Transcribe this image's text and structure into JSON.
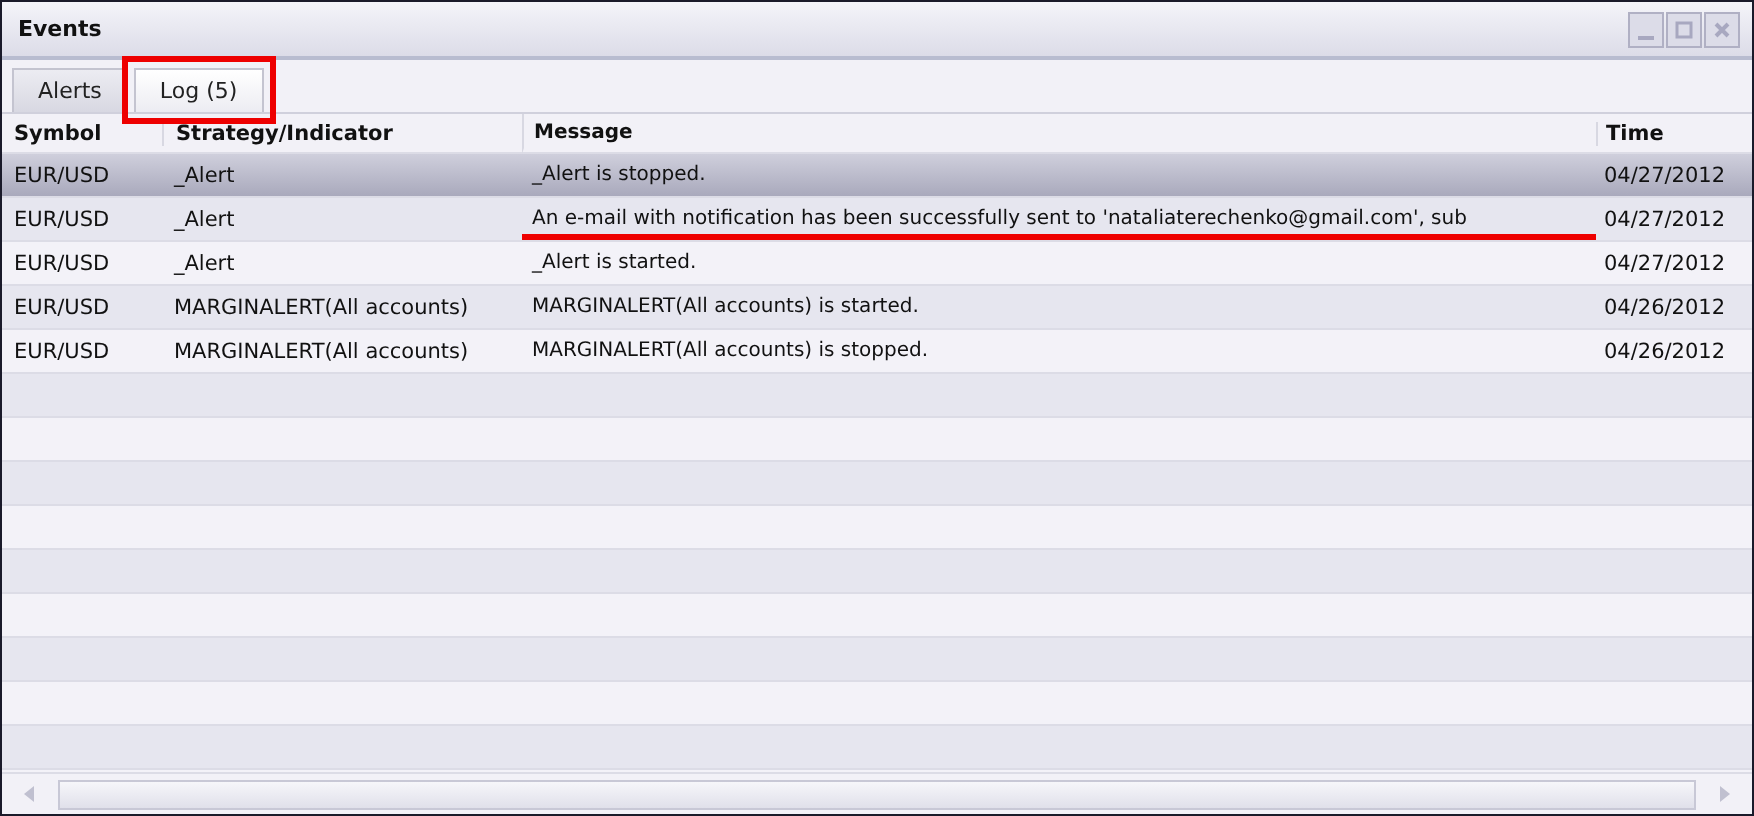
{
  "window": {
    "title": "Events"
  },
  "tabs": [
    {
      "label": "Alerts",
      "selected": false,
      "annotated": false
    },
    {
      "label": "Log (5)",
      "selected": true,
      "annotated": true
    }
  ],
  "table": {
    "columns": [
      "Symbol",
      "Strategy/Indicator",
      "Message",
      "Time"
    ],
    "rows": [
      {
        "cells": [
          "EUR/USD",
          "_Alert",
          "_Alert is stopped.",
          "04/27/2012"
        ],
        "selected": true,
        "underlined": false
      },
      {
        "cells": [
          "EUR/USD",
          "_Alert",
          "An e-mail with notification has been successfully sent to 'nataliaterechenko@gmail.com', sub",
          "04/27/2012"
        ],
        "selected": false,
        "underlined": true
      },
      {
        "cells": [
          "EUR/USD",
          "_Alert",
          "_Alert is started.",
          "04/27/2012"
        ],
        "selected": false,
        "underlined": false
      },
      {
        "cells": [
          "EUR/USD",
          "MARGINALERT(All accounts)",
          "MARGINALERT(All accounts) is started.",
          "04/26/2012"
        ],
        "selected": false,
        "underlined": false
      },
      {
        "cells": [
          "EUR/USD",
          "MARGINALERT(All accounts)",
          "MARGINALERT(All accounts) is stopped.",
          "04/26/2012"
        ],
        "selected": false,
        "underlined": false
      }
    ]
  }
}
